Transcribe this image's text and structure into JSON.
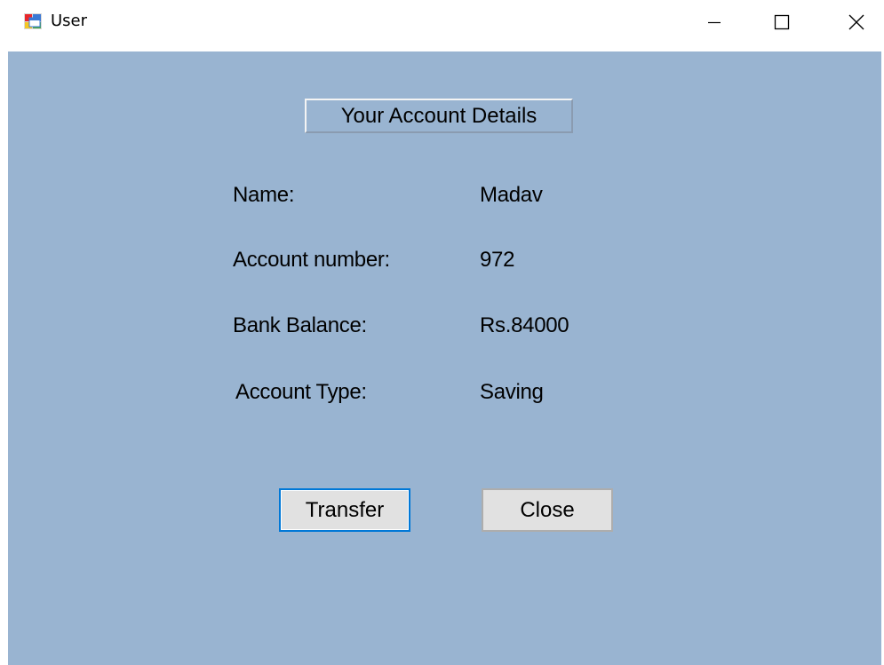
{
  "window": {
    "title": "User",
    "icon": "windows-form-icon",
    "controls": {
      "minimize": "minimize-icon",
      "maximize": "maximize-icon",
      "close": "close-icon"
    }
  },
  "heading": "Your Account Details",
  "fields": {
    "name_label": "Name:",
    "name_value": "Madav",
    "account_number_label": "Account number:",
    "account_number_value": "972",
    "balance_label": "Bank Balance:",
    "balance_value": "Rs.84000",
    "type_label": "Account Type:",
    "type_value": "Saving"
  },
  "buttons": {
    "transfer": "Transfer",
    "close": "Close"
  },
  "colors": {
    "client_background": "#99b4d1",
    "focus_border": "#0078d7"
  }
}
